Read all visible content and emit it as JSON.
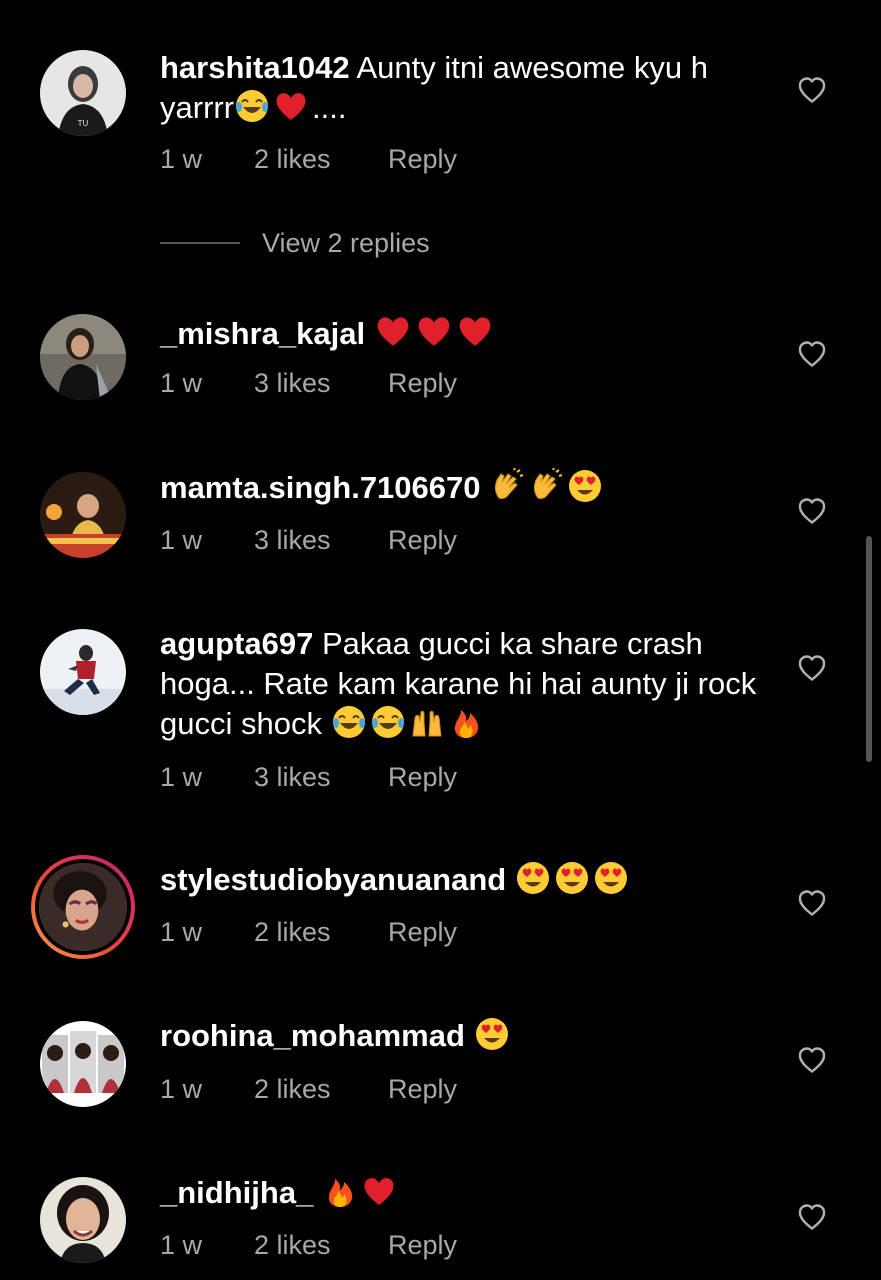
{
  "comments": [
    {
      "username": "harshita1042",
      "text": " Aunty itni awesome kyu h yarrrr",
      "text_line2_suffix": "....",
      "emojis": [
        "laughing-crying-emoji",
        "red-heart-emoji"
      ],
      "time": "1 w",
      "likes": "2 likes",
      "reply": "Reply",
      "view_replies": "View 2 replies"
    },
    {
      "username": "_mishra_kajal",
      "text": " ",
      "emojis": [
        "red-heart-emoji",
        "red-heart-emoji",
        "red-heart-emoji"
      ],
      "time": "1 w",
      "likes": "3 likes",
      "reply": "Reply"
    },
    {
      "username": "mamta.singh.7106670",
      "text": " ",
      "emojis": [
        "clapping-hands-emoji",
        "clapping-hands-emoji",
        "heart-eyes-emoji"
      ],
      "time": "1 w",
      "likes": "3 likes",
      "reply": "Reply"
    },
    {
      "username": "agupta697",
      "text": " Pakaa gucci ka share crash hoga... Rate kam karane hi hai aunty ji rock gucci shock ",
      "emojis": [
        "laughing-crying-emoji",
        "laughing-crying-emoji",
        "raised-hands-emoji",
        "fire-emoji"
      ],
      "time": "1 w",
      "likes": "3 likes",
      "reply": "Reply"
    },
    {
      "username": "stylestudiobyanuanand",
      "text": " ",
      "emojis": [
        "heart-eyes-emoji",
        "heart-eyes-emoji",
        "heart-eyes-emoji"
      ],
      "time": "1 w",
      "likes": "2 likes",
      "reply": "Reply"
    },
    {
      "username": "roohina_mohammad",
      "text": " ",
      "emojis": [
        "heart-eyes-emoji"
      ],
      "time": "1 w",
      "likes": "2 likes",
      "reply": "Reply"
    },
    {
      "username": "_nidhijha_",
      "text": " ",
      "emojis": [
        "fire-emoji",
        "red-heart-emoji"
      ],
      "time": "1 w",
      "likes": "2 likes",
      "reply": "Reply"
    }
  ],
  "colors": {
    "background": "#000000",
    "primary_text": "#ffffff",
    "secondary_text": "#a8a8a8",
    "story_ring_start": "#f9a23b",
    "story_ring_end": "#c51f77"
  }
}
